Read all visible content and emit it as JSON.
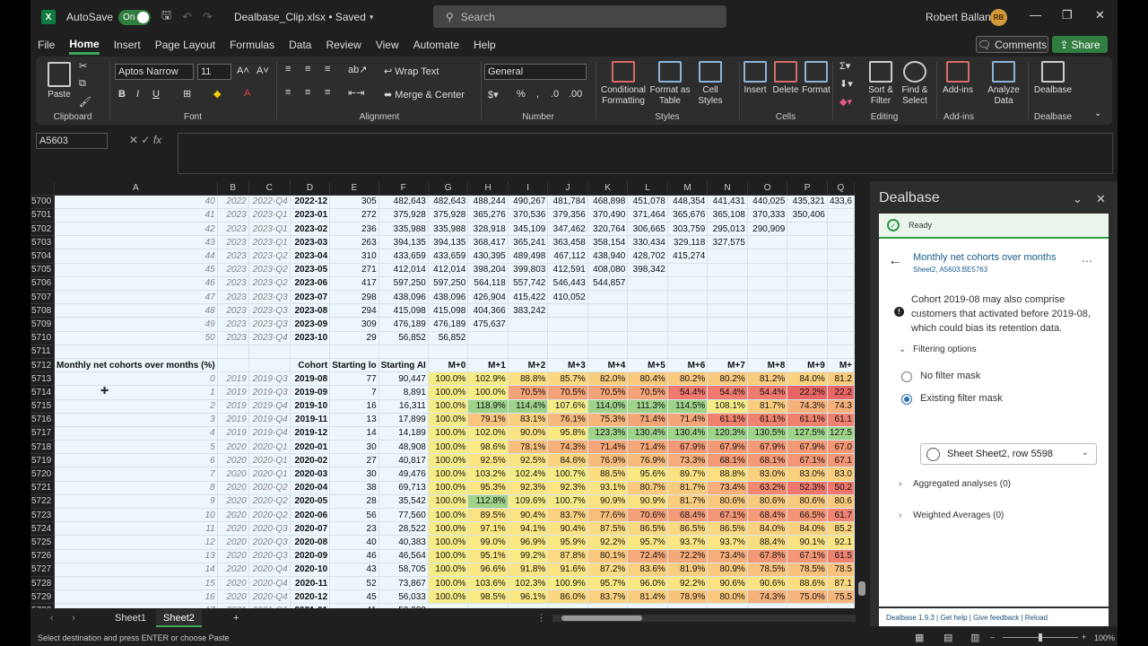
{
  "window": {
    "autosave_label": "AutoSave",
    "autosave_state": "On",
    "doc_title": "Dealbase_Clip.xlsx • Saved",
    "search_placeholder": "Search",
    "user_name": "Robert Ballante",
    "user_initials": "RB"
  },
  "menu": [
    "File",
    "Home",
    "Insert",
    "Page Layout",
    "Formulas",
    "Data",
    "Review",
    "View",
    "Automate",
    "Help"
  ],
  "menu_active": "Home",
  "buttons": {
    "comments": "Comments",
    "share": "Share"
  },
  "ribbon": {
    "paste": "Paste",
    "clipboard": "Clipboard",
    "font_name": "Aptos Narrow",
    "font_size": "11",
    "font": "Font",
    "wrap_text": "Wrap Text",
    "merge_center": "Merge & Center",
    "alignment": "Alignment",
    "number_format": "General",
    "number": "Number",
    "conditional_formatting_1": "Conditional",
    "conditional_formatting_2": "Formatting",
    "format_as_table_1": "Format as",
    "format_as_table_2": "Table",
    "cell_styles_1": "Cell",
    "cell_styles_2": "Styles",
    "styles": "Styles",
    "insert": "Insert",
    "delete": "Delete",
    "format": "Format",
    "cells": "Cells",
    "sort_filter_1": "Sort &",
    "sort_filter_2": "Filter",
    "find_select_1": "Find &",
    "find_select_2": "Select",
    "editing": "Editing",
    "addins": "Add-ins",
    "analyze_1": "Analyze",
    "analyze_2": "Data",
    "dealbase": "Dealbase"
  },
  "namebox": "A5603",
  "columns": [
    "A",
    "B",
    "C",
    "D",
    "E",
    "F",
    "G",
    "H",
    "I",
    "J",
    "K",
    "L",
    "M",
    "N",
    "O",
    "P",
    "Q"
  ],
  "rows_top": [
    [
      "5700",
      "40",
      "2022",
      "2022-Q4",
      "2022-12",
      "305",
      "482,643",
      "482,643",
      "488,244",
      "490,267",
      "481,784",
      "468,898",
      "451,078",
      "448,354",
      "441,431",
      "440,025",
      "435,321",
      "433,6"
    ],
    [
      "5701",
      "41",
      "2023",
      "2023-Q1",
      "2023-01",
      "272",
      "375,928",
      "375,928",
      "365,276",
      "370,536",
      "379,356",
      "370,490",
      "371,464",
      "365,676",
      "365,108",
      "370,333",
      "350,406",
      ""
    ],
    [
      "5702",
      "42",
      "2023",
      "2023-Q1",
      "2023-02",
      "236",
      "335,988",
      "335,988",
      "328,918",
      "345,109",
      "347,462",
      "320,764",
      "306,665",
      "303,759",
      "295,013",
      "290,909",
      "",
      ""
    ],
    [
      "5703",
      "43",
      "2023",
      "2023-Q1",
      "2023-03",
      "263",
      "394,135",
      "394,135",
      "368,417",
      "365,241",
      "363,458",
      "358,154",
      "330,434",
      "329,118",
      "327,575",
      "",
      "",
      ""
    ],
    [
      "5704",
      "44",
      "2023",
      "2023-Q2",
      "2023-04",
      "310",
      "433,659",
      "433,659",
      "430,395",
      "489,498",
      "467,112",
      "438,940",
      "428,702",
      "415,274",
      "",
      "",
      "",
      ""
    ],
    [
      "5705",
      "45",
      "2023",
      "2023-Q2",
      "2023-05",
      "271",
      "412,014",
      "412,014",
      "398,204",
      "399,803",
      "412,591",
      "408,080",
      "398,342",
      "",
      "",
      "",
      "",
      ""
    ],
    [
      "5706",
      "46",
      "2023",
      "2023-Q2",
      "2023-06",
      "417",
      "597,250",
      "597,250",
      "564,118",
      "557,742",
      "546,443",
      "544,857",
      "",
      "",
      "",
      "",
      "",
      ""
    ],
    [
      "5707",
      "47",
      "2023",
      "2023-Q3",
      "2023-07",
      "298",
      "438,096",
      "438,096",
      "426,904",
      "415,422",
      "410,052",
      "",
      "",
      "",
      "",
      "",
      "",
      ""
    ],
    [
      "5708",
      "48",
      "2023",
      "2023-Q3",
      "2023-08",
      "294",
      "415,098",
      "415,098",
      "404,366",
      "383,242",
      "",
      "",
      "",
      "",
      "",
      "",
      "",
      ""
    ],
    [
      "5709",
      "49",
      "2023",
      "2023-Q3",
      "2023-09",
      "309",
      "476,189",
      "476,189",
      "475,637",
      "",
      "",
      "",
      "",
      "",
      "",
      "",
      "",
      ""
    ],
    [
      "5710",
      "50",
      "2023",
      "2023-Q4",
      "2023-10",
      "29",
      "56,852",
      "56,852",
      "",
      "",
      "",
      "",
      "",
      "",
      "",
      "",
      "",
      ""
    ],
    [
      "5711",
      "",
      "",
      "",
      "",
      "",
      "",
      "",
      "",
      "",
      "",
      "",
      "",
      "",
      "",
      "",
      "",
      ""
    ]
  ],
  "header_row": [
    "5712",
    "Monthly net cohorts over months (%)",
    "",
    "",
    "Cohort",
    "Starting lo",
    "Starting AI",
    "M+0",
    "M+1",
    "M+2",
    "M+3",
    "M+4",
    "M+5",
    "M+6",
    "M+7",
    "M+8",
    "M+9",
    "M+"
  ],
  "rows_pct": [
    [
      "5713",
      "0",
      "2019",
      "2019-Q3",
      "2019-08",
      "77",
      "90,447",
      "100.0%",
      "102.9%",
      "88.8%",
      "85.7%",
      "82.0%",
      "80.4%",
      "80.2%",
      "80.2%",
      "81.2%",
      "84.0%",
      "81.2"
    ],
    [
      "5714",
      "1",
      "2019",
      "2019-Q3",
      "2019-09",
      "7",
      "8,891",
      "100.0%",
      "100.0%",
      "70.5%",
      "70.5%",
      "70.5%",
      "70.5%",
      "54.4%",
      "54.4%",
      "54.4%",
      "22.2%",
      "22.2"
    ],
    [
      "5715",
      "2",
      "2019",
      "2019-Q4",
      "2019-10",
      "16",
      "16,311",
      "100.0%",
      "118.9%",
      "114.4%",
      "107.6%",
      "114.0%",
      "111.3%",
      "114.5%",
      "108.1%",
      "81.7%",
      "74.3%",
      "74.3"
    ],
    [
      "5716",
      "3",
      "2019",
      "2019-Q4",
      "2019-11",
      "13",
      "17,899",
      "100.0%",
      "79.1%",
      "83.1%",
      "76.1%",
      "75.3%",
      "71.4%",
      "71.4%",
      "61.1%",
      "61.1%",
      "61.1%",
      "61.1"
    ],
    [
      "5717",
      "4",
      "2019",
      "2019-Q4",
      "2019-12",
      "14",
      "14,189",
      "100.0%",
      "102.0%",
      "90.0%",
      "95.8%",
      "123.3%",
      "130.4%",
      "130.4%",
      "120.3%",
      "130.5%",
      "127.5%",
      "127.5"
    ],
    [
      "5718",
      "5",
      "2020",
      "2020-Q1",
      "2020-01",
      "30",
      "48,908",
      "100.0%",
      "98.6%",
      "78.1%",
      "74.3%",
      "71.4%",
      "71.4%",
      "67.9%",
      "67.9%",
      "67.9%",
      "67.9%",
      "67.0"
    ],
    [
      "5719",
      "6",
      "2020",
      "2020-Q1",
      "2020-02",
      "27",
      "40,817",
      "100.0%",
      "92.5%",
      "92.5%",
      "84.6%",
      "76.9%",
      "76.9%",
      "73.3%",
      "68.1%",
      "68.1%",
      "67.1%",
      "67.1"
    ],
    [
      "5720",
      "7",
      "2020",
      "2020-Q1",
      "2020-03",
      "30",
      "49,476",
      "100.0%",
      "103.2%",
      "102.4%",
      "100.7%",
      "88.5%",
      "95.6%",
      "89.7%",
      "88.8%",
      "83.0%",
      "83.0%",
      "83.0"
    ],
    [
      "5721",
      "8",
      "2020",
      "2020-Q2",
      "2020-04",
      "38",
      "69,713",
      "100.0%",
      "95.3%",
      "92.3%",
      "92.3%",
      "93.1%",
      "80.7%",
      "81.7%",
      "73.4%",
      "63.2%",
      "52.3%",
      "50.2"
    ],
    [
      "5722",
      "9",
      "2020",
      "2020-Q2",
      "2020-05",
      "28",
      "35,542",
      "100.0%",
      "112.8%",
      "109.6%",
      "100.7%",
      "90.9%",
      "90.9%",
      "81.7%",
      "80.6%",
      "80.6%",
      "80.6%",
      "80.6"
    ],
    [
      "5723",
      "10",
      "2020",
      "2020-Q2",
      "2020-06",
      "56",
      "77,560",
      "100.0%",
      "89.5%",
      "90.4%",
      "83.7%",
      "77.6%",
      "70.6%",
      "68.4%",
      "67.1%",
      "68.4%",
      "66.5%",
      "61.7"
    ],
    [
      "5724",
      "11",
      "2020",
      "2020-Q3",
      "2020-07",
      "23",
      "28,522",
      "100.0%",
      "97.1%",
      "94.1%",
      "90.4%",
      "87.5%",
      "86.5%",
      "86.5%",
      "86.5%",
      "84.0%",
      "84.0%",
      "85.2"
    ],
    [
      "5725",
      "12",
      "2020",
      "2020-Q3",
      "2020-08",
      "40",
      "40,383",
      "100.0%",
      "99.0%",
      "96.9%",
      "95.9%",
      "92.2%",
      "95.7%",
      "93.7%",
      "93.7%",
      "88.4%",
      "90.1%",
      "92.1"
    ],
    [
      "5726",
      "13",
      "2020",
      "2020-Q3",
      "2020-09",
      "46",
      "46,564",
      "100.0%",
      "95.1%",
      "99.2%",
      "87.8%",
      "80.1%",
      "72.4%",
      "72.2%",
      "73.4%",
      "67.8%",
      "67.1%",
      "61.5"
    ],
    [
      "5727",
      "14",
      "2020",
      "2020-Q4",
      "2020-10",
      "43",
      "58,705",
      "100.0%",
      "96.6%",
      "91.8%",
      "91.6%",
      "87.2%",
      "83.6%",
      "81.9%",
      "80.9%",
      "78.5%",
      "78.5%",
      "78.5"
    ],
    [
      "5728",
      "15",
      "2020",
      "2020-Q4",
      "2020-11",
      "52",
      "73,867",
      "100.0%",
      "103.6%",
      "102.3%",
      "100.9%",
      "95.7%",
      "96.0%",
      "92.2%",
      "90.6%",
      "90.6%",
      "88.6%",
      "87.1"
    ],
    [
      "5729",
      "16",
      "2020",
      "2020-Q4",
      "2020-12",
      "45",
      "56,033",
      "100.0%",
      "98.5%",
      "96.1%",
      "86.0%",
      "83.7%",
      "81.4%",
      "78.9%",
      "80.0%",
      "74.3%",
      "75.0%",
      "75.5"
    ],
    [
      "5730",
      "17",
      "2021",
      "2021-Q1",
      "2021-01",
      "41",
      "50,233",
      "",
      "",
      "",
      "",
      "",
      "",
      "",
      "",
      "",
      "",
      ""
    ]
  ],
  "tabs": [
    "Sheet1",
    "Sheet2"
  ],
  "active_tab": "Sheet2",
  "status": {
    "message": "Select destination and press ENTER or choose Paste",
    "zoom": "100%"
  },
  "pane": {
    "title": "Dealbase",
    "ready": "Ready",
    "analysis_title": "Monthly net cohorts over months",
    "analysis_sub": "Sheet2, A5603:BE5763",
    "warning": "Cohort 2019-08 may also comprise customers that activated before 2019-08, which could bias its retention data.",
    "filtering": "Filtering options",
    "no_filter": "No filter mask",
    "existing_filter": "Existing filter mask",
    "filter_select": "Sheet Sheet2, row 5598",
    "aggregated": "Aggregated analyses (0)",
    "weighted": "Weighted Averages (0)",
    "footer": "Dealbase 1.9.3 | Get help | Give feedback | Reload"
  }
}
